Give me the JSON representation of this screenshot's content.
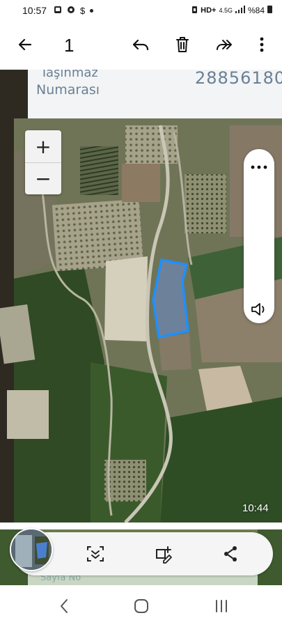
{
  "status_bar": {
    "time": "10:57",
    "icons_left": [
      "photo-icon",
      "chrome-icon",
      "dollar-icon",
      "dot-icon"
    ],
    "network_label": "HD+",
    "network_type": "4.5G",
    "battery": "%84"
  },
  "top_bar": {
    "counter": "1",
    "icons": [
      "back-arrow-icon",
      "reply-icon",
      "trash-icon",
      "forward-icon",
      "more-vert-icon"
    ]
  },
  "photo": {
    "doc_header_line1": "Taşınmaz",
    "doc_header_line2": "Numarası",
    "doc_header_number": "28856180",
    "map_zoom_in": "+",
    "map_zoom_out": "−",
    "parcel_highlight_color": "#1e90ff",
    "video_time": "10:44",
    "doc_bottom_text": "Sayfa No"
  },
  "side_controls": {
    "icons": [
      "more-horiz-icon",
      "volume-icon"
    ]
  },
  "bottom_toolbar": {
    "icons": [
      "scan-text-icon",
      "edit-crop-icon",
      "share-icon"
    ]
  },
  "nav_bar": {
    "icons": [
      "nav-back-icon",
      "nav-home-icon",
      "nav-recents-icon"
    ]
  }
}
